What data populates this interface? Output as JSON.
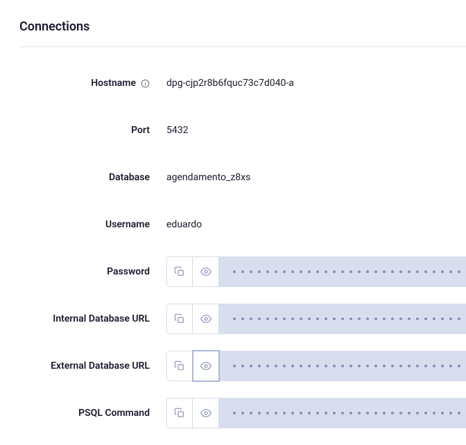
{
  "section": {
    "title": "Connections"
  },
  "fields": {
    "hostname": {
      "label": "Hostname",
      "value": "dpg-cjp2r8b6fquc73c7d040-a",
      "hasInfo": true
    },
    "port": {
      "label": "Port",
      "value": "5432"
    },
    "database": {
      "label": "Database",
      "value": "agendamento_z8xs"
    },
    "username": {
      "label": "Username",
      "value": "eduardo"
    },
    "password": {
      "label": "Password"
    },
    "internal_url": {
      "label": "Internal Database URL"
    },
    "external_url": {
      "label": "External Database URL"
    },
    "psql_command": {
      "label": "PSQL Command"
    }
  }
}
